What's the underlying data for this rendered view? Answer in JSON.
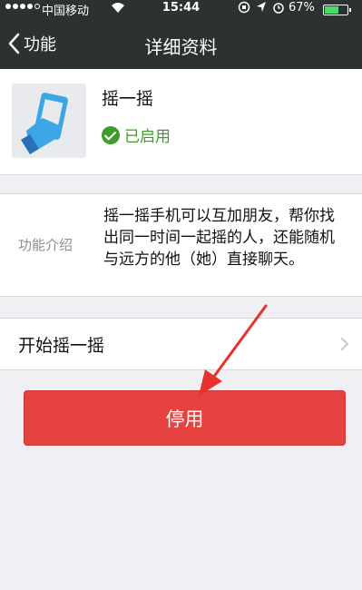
{
  "status_bar": {
    "carrier": "中国移动",
    "time": "15:44",
    "battery": "67%",
    "battery_level": 0.67,
    "signal_bars": 4,
    "icons": [
      "wifi-icon",
      "rotation-lock-icon",
      "location-icon",
      "alarm-icon",
      "battery-icon"
    ]
  },
  "nav": {
    "back_label": "功能",
    "title": "详细资料"
  },
  "app": {
    "name": "摇一摇",
    "status": "已启用",
    "status_color": "#3f9b2c",
    "icon": "shake-phone-icon"
  },
  "description": {
    "label": "功能介绍",
    "text": "摇一摇手机可以互加朋友，帮你找出同一时间一起摇的人，还能随机与远方的他（她）直接聊天。"
  },
  "start_row": {
    "label": "开始摇一摇"
  },
  "disable_button": {
    "label": "停用",
    "color": "#e64340"
  },
  "annotation": {
    "arrow_color": "#e8312b"
  }
}
